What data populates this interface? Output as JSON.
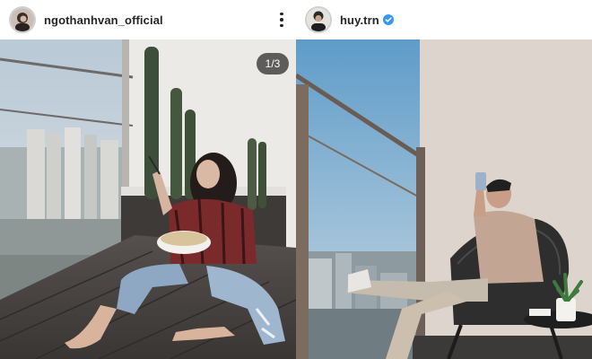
{
  "posts": [
    {
      "username": "ngothanhvan_official",
      "verified": false,
      "has_more_menu": true,
      "carousel_counter": "1/3",
      "avatar_icon": "profile-photo"
    },
    {
      "username": "huy.trn",
      "verified": true,
      "has_more_menu": false,
      "avatar_icon": "profile-photo"
    }
  ],
  "colors": {
    "text": "#262626",
    "verified_badge": "#3897f0",
    "counter_bg": "#262626"
  }
}
